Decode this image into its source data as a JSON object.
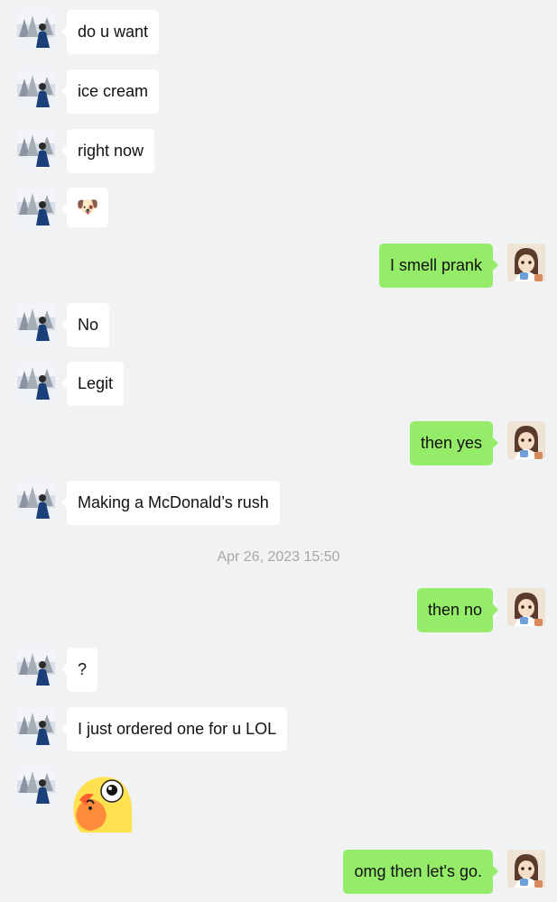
{
  "messages": [
    {
      "side": "in",
      "text": "do u want"
    },
    {
      "side": "in",
      "text": "ice cream"
    },
    {
      "side": "in",
      "text": "right now"
    },
    {
      "side": "in",
      "emoji": "doge-emoji",
      "text": "🐶"
    },
    {
      "side": "out",
      "text": "I smell prank"
    },
    {
      "side": "in",
      "text": "No"
    },
    {
      "side": "in",
      "text": "Legit"
    },
    {
      "side": "out",
      "text": "then yes"
    },
    {
      "side": "in",
      "text": "Making a McDonald’s rush"
    },
    {
      "side": "out",
      "text": "then no"
    },
    {
      "side": "in",
      "text": "?"
    },
    {
      "side": "in",
      "text": "I just ordered one for u LOL"
    },
    {
      "side": "in",
      "sticker": "parrot-sticker"
    },
    {
      "side": "out",
      "text": "omg then let's go."
    }
  ],
  "timestamp": "Apr 26, 2023 15:50",
  "colors": {
    "background": "#f1f2f4",
    "incoming_bubble": "#ffffff",
    "outgoing_bubble": "#95ec69",
    "timestamp_text": "#a7a7a7"
  }
}
